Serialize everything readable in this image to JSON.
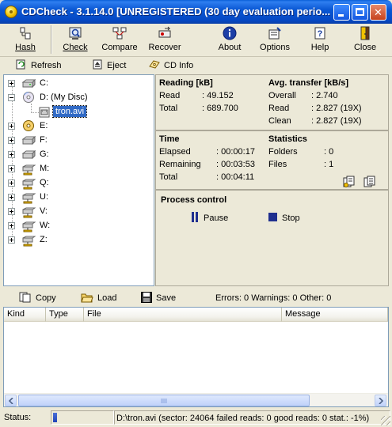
{
  "window": {
    "title": "CDCheck - 3.1.14.0 [UNREGISTERED (30 day evaluation perio...",
    "minimize_label": "",
    "maximize_label": "",
    "close_glyph": "✕"
  },
  "toolbar": {
    "hash": "Hash",
    "check": "Check",
    "compare": "Compare",
    "recover": "Recover",
    "about": "About",
    "options": "Options",
    "help": "Help",
    "close": "Close"
  },
  "toolbar2": {
    "refresh": "Refresh",
    "eject": "Eject",
    "cd_info": "CD Info"
  },
  "tree": {
    "drives": [
      {
        "label": "C:",
        "expander": "plus",
        "icon": "hard-drive-icon"
      },
      {
        "label": "D: (My Disc)",
        "expander": "minus",
        "icon": "cd-drive-icon"
      },
      {
        "label": "tron.avi",
        "expander": "",
        "icon": "video-file-icon"
      },
      {
        "label": "E:",
        "expander": "plus",
        "icon": "cd-drive-icon"
      },
      {
        "label": "F:",
        "expander": "plus",
        "icon": "hard-drive-icon"
      },
      {
        "label": "G:",
        "expander": "plus",
        "icon": "hard-drive-icon"
      },
      {
        "label": "M:",
        "expander": "plus",
        "icon": "network-drive-icon"
      },
      {
        "label": "Q:",
        "expander": "plus",
        "icon": "network-drive-icon"
      },
      {
        "label": "U:",
        "expander": "plus",
        "icon": "network-drive-icon"
      },
      {
        "label": "V:",
        "expander": "plus",
        "icon": "network-drive-icon"
      },
      {
        "label": "W:",
        "expander": "plus",
        "icon": "network-drive-icon"
      },
      {
        "label": "Z:",
        "expander": "plus",
        "icon": "network-drive-icon"
      }
    ]
  },
  "reading": {
    "title": "Reading [kB]",
    "read_label": "Read",
    "read_value": ": 49.152",
    "total_label": "Total",
    "total_value": ": 689.700"
  },
  "transfer": {
    "title": "Avg. transfer [kB/s]",
    "overall_label": "Overall",
    "overall_value": ": 2.740",
    "read_label": "Read",
    "read_value": ": 2.827 (19X)",
    "clean_label": "Clean",
    "clean_value": ": 2.827 (19X)"
  },
  "time": {
    "title": "Time",
    "elapsed_label": "Elapsed",
    "elapsed_value": ": 00:00:17",
    "remaining_label": "Remaining",
    "remaining_value": ": 00:03:53",
    "total_label": "Total",
    "total_value": ": 00:04:11"
  },
  "statistics": {
    "title": "Statistics",
    "folders_label": "Folders",
    "folders_value": ": 0",
    "files_label": "Files",
    "files_value": ": 1"
  },
  "process": {
    "title": "Process control",
    "pause": "Pause",
    "stop": "Stop"
  },
  "toolbar3": {
    "copy": "Copy",
    "load": "Load",
    "save": "Save",
    "summary": "Errors: 0 Warnings: 0 Other: 0"
  },
  "list": {
    "columns": [
      "Kind",
      "Type",
      "File",
      "Message"
    ]
  },
  "status": {
    "label": "Status:",
    "progress_fraction": 0.07,
    "message": "D:\\tron.avi (sector: 24064 failed reads: 0 good reads: 0 stat.: -1%)"
  },
  "colors": {
    "titlebar": "#0a58d4",
    "window_bg": "#ece9d8",
    "selection": "#316ac5",
    "progress": "#2a4fc8"
  }
}
